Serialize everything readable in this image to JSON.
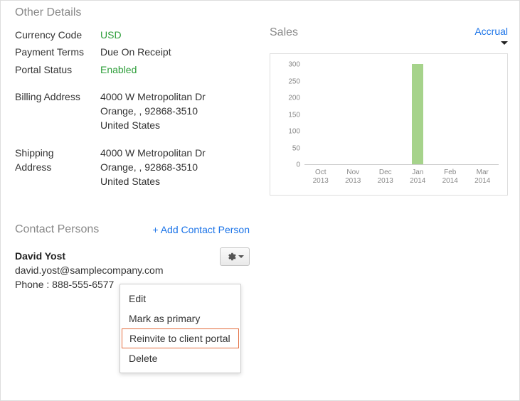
{
  "section_other_details": "Other Details",
  "details": {
    "currency_label": "Currency Code",
    "currency_value": "USD",
    "terms_label": "Payment Terms",
    "terms_value": "Due On Receipt",
    "portal_label": "Portal Status",
    "portal_value": "Enabled"
  },
  "billing": {
    "label": "Billing Address",
    "line1": "4000 W Metropolitan Dr",
    "line2": "Orange, , 92868-3510",
    "line3": "United States"
  },
  "shipping": {
    "label_line1": "Shipping",
    "label_line2": "Address",
    "line1": "4000 W Metropolitan Dr",
    "line2": "Orange, , 92868-3510",
    "line3": "United States"
  },
  "section_contacts": "Contact Persons",
  "add_contact_label": "+ Add Contact Person",
  "contact": {
    "name": "David Yost",
    "email": "david.yost@samplecompany.com",
    "phone": "Phone : 888-555-6577"
  },
  "menu": {
    "edit": "Edit",
    "mark_primary": "Mark as primary",
    "reinvite": "Reinvite to client portal",
    "delete": "Delete"
  },
  "chart": {
    "title": "Sales",
    "basis": "Accrual"
  },
  "chart_data": {
    "type": "bar",
    "categories": [
      "Oct 2013",
      "Nov 2013",
      "Dec 2013",
      "Jan 2014",
      "Feb 2014",
      "Mar 2014"
    ],
    "values": [
      0,
      0,
      0,
      300,
      0,
      0
    ],
    "title": "Sales",
    "xlabel": "",
    "ylabel": "",
    "ylim": [
      0,
      300
    ],
    "y_ticks": [
      0,
      50,
      100,
      150,
      200,
      250,
      300
    ]
  }
}
